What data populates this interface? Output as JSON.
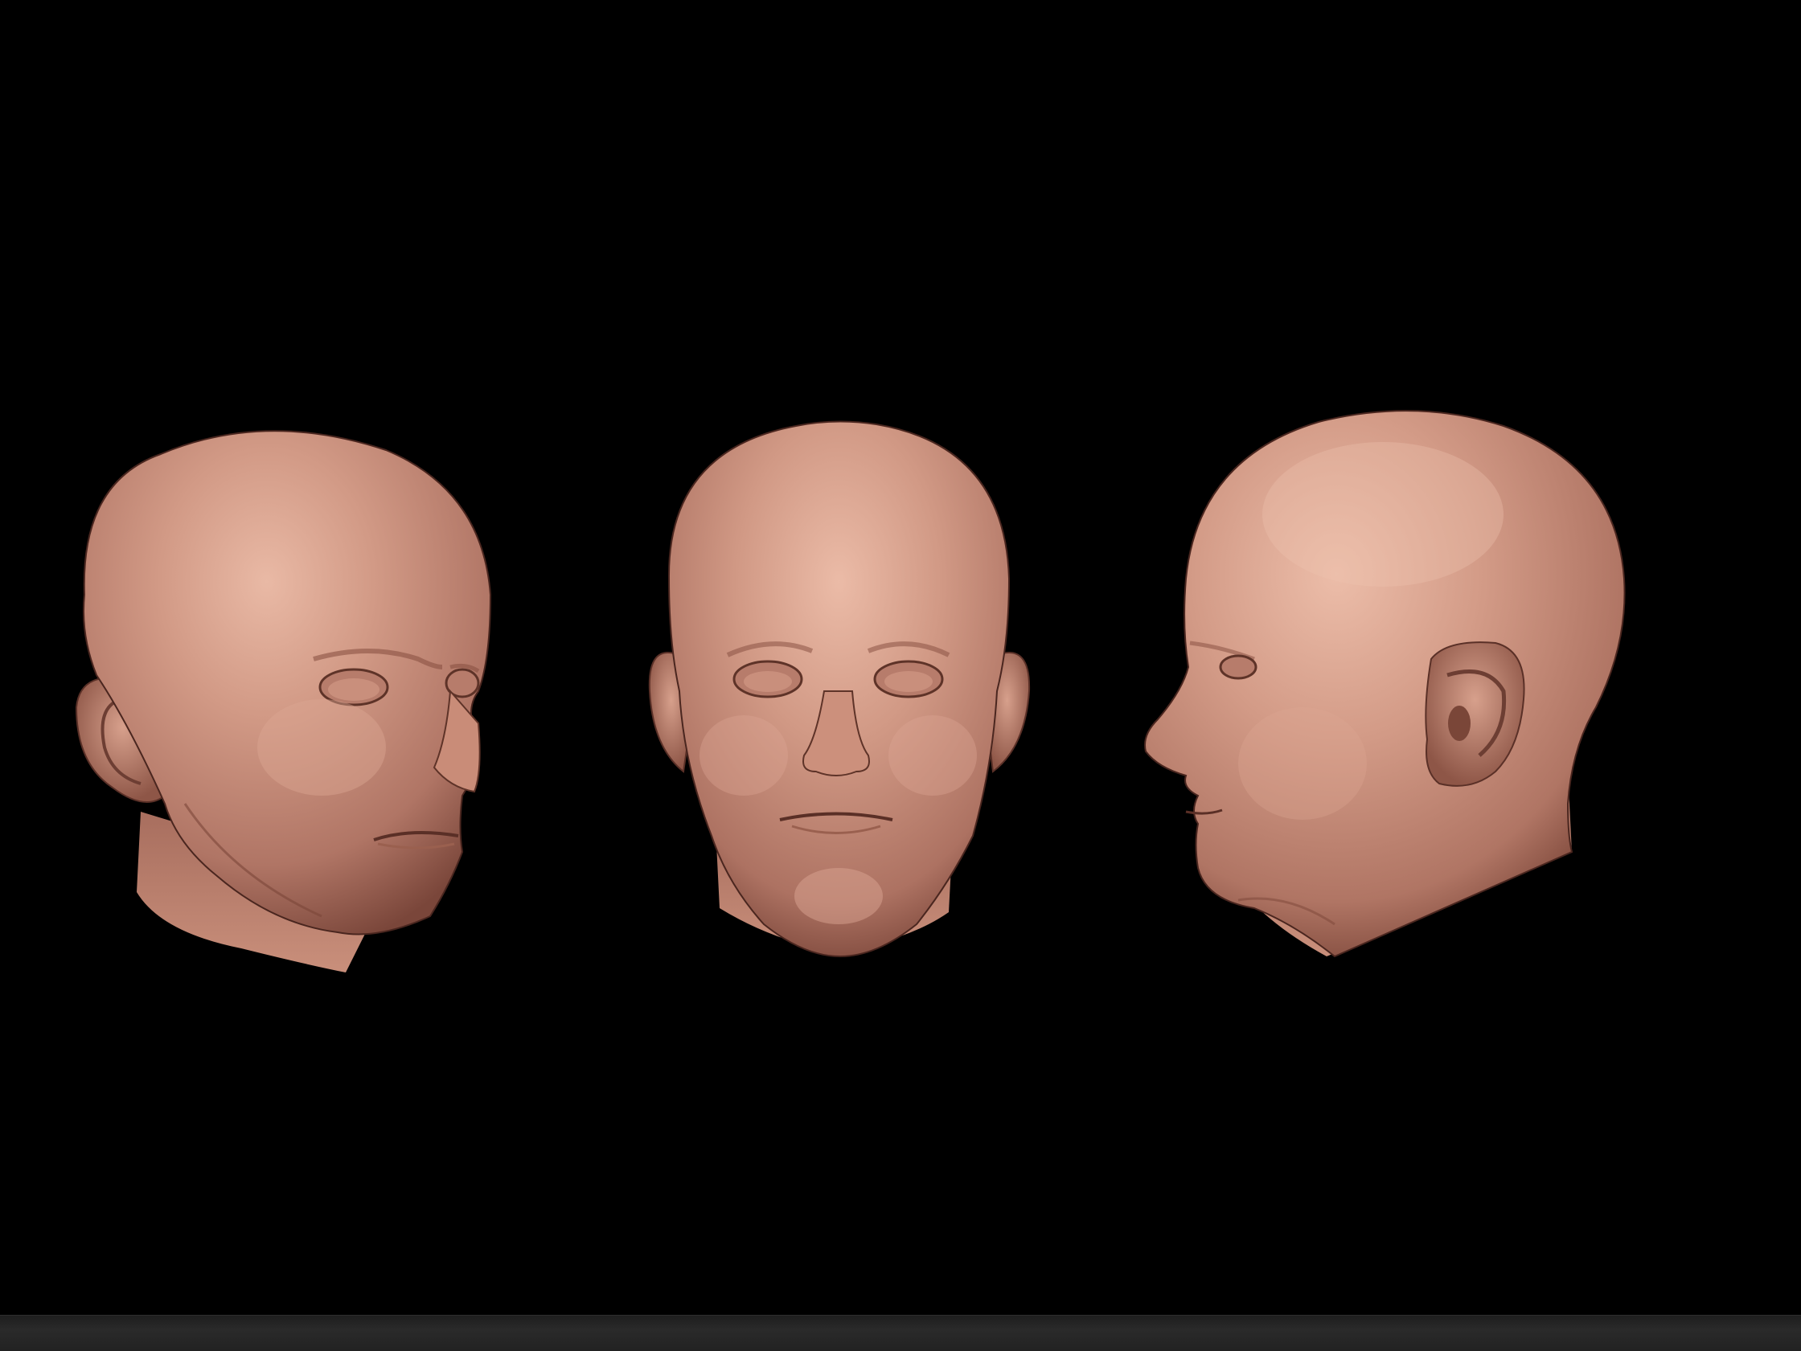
{
  "scene": {
    "background_color": "#000000",
    "material_color": "#c48a78",
    "material_highlight": "#e7b6a2",
    "material_shadow": "#6e4036",
    "models": [
      {
        "view": "three-quarter-right"
      },
      {
        "view": "front"
      },
      {
        "view": "profile-left"
      }
    ]
  },
  "bottom_bar": {
    "color": "#262626"
  }
}
